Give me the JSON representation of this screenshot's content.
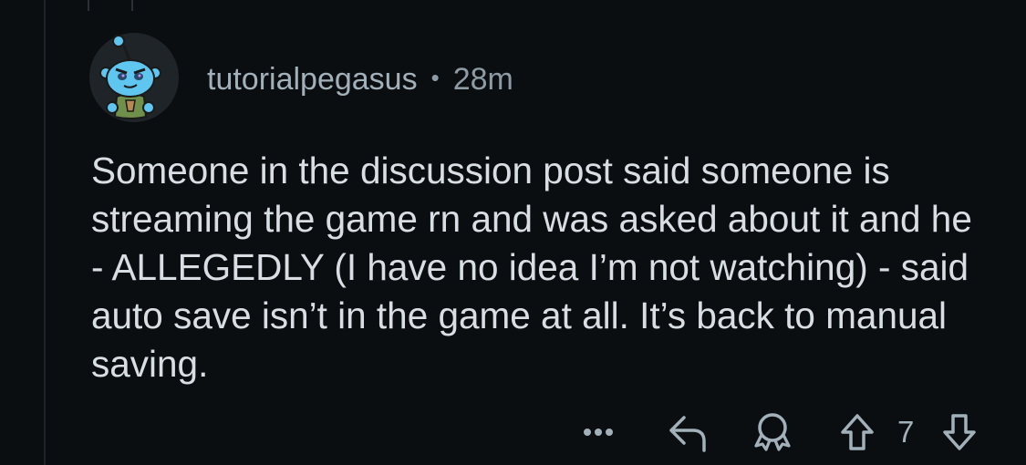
{
  "comment": {
    "author": "tutorialpegasus",
    "separator": "•",
    "timestamp": "28m",
    "avatar_icon": "snoo-avatar-icon",
    "body": "Someone in the discussion post said someone is streaming the game rn and was asked about it and he - ALLEGEDLY (I have no idea I’m not watching) - said auto save isn’t in the game at all. It’s back to manual saving."
  },
  "actions": {
    "more_icon": "more-options-icon",
    "reply_icon": "reply-arrow-icon",
    "award_icon": "award-icon",
    "upvote_icon": "upvote-arrow-icon",
    "vote_count": "7",
    "downvote_icon": "downvote-arrow-icon"
  },
  "colors": {
    "background": "#0b0e11",
    "body_text": "#d8dee3",
    "meta_text": "#8d9ba4",
    "icon": "#a2b0b9",
    "avatar_snoo": "#5fc6f0"
  }
}
